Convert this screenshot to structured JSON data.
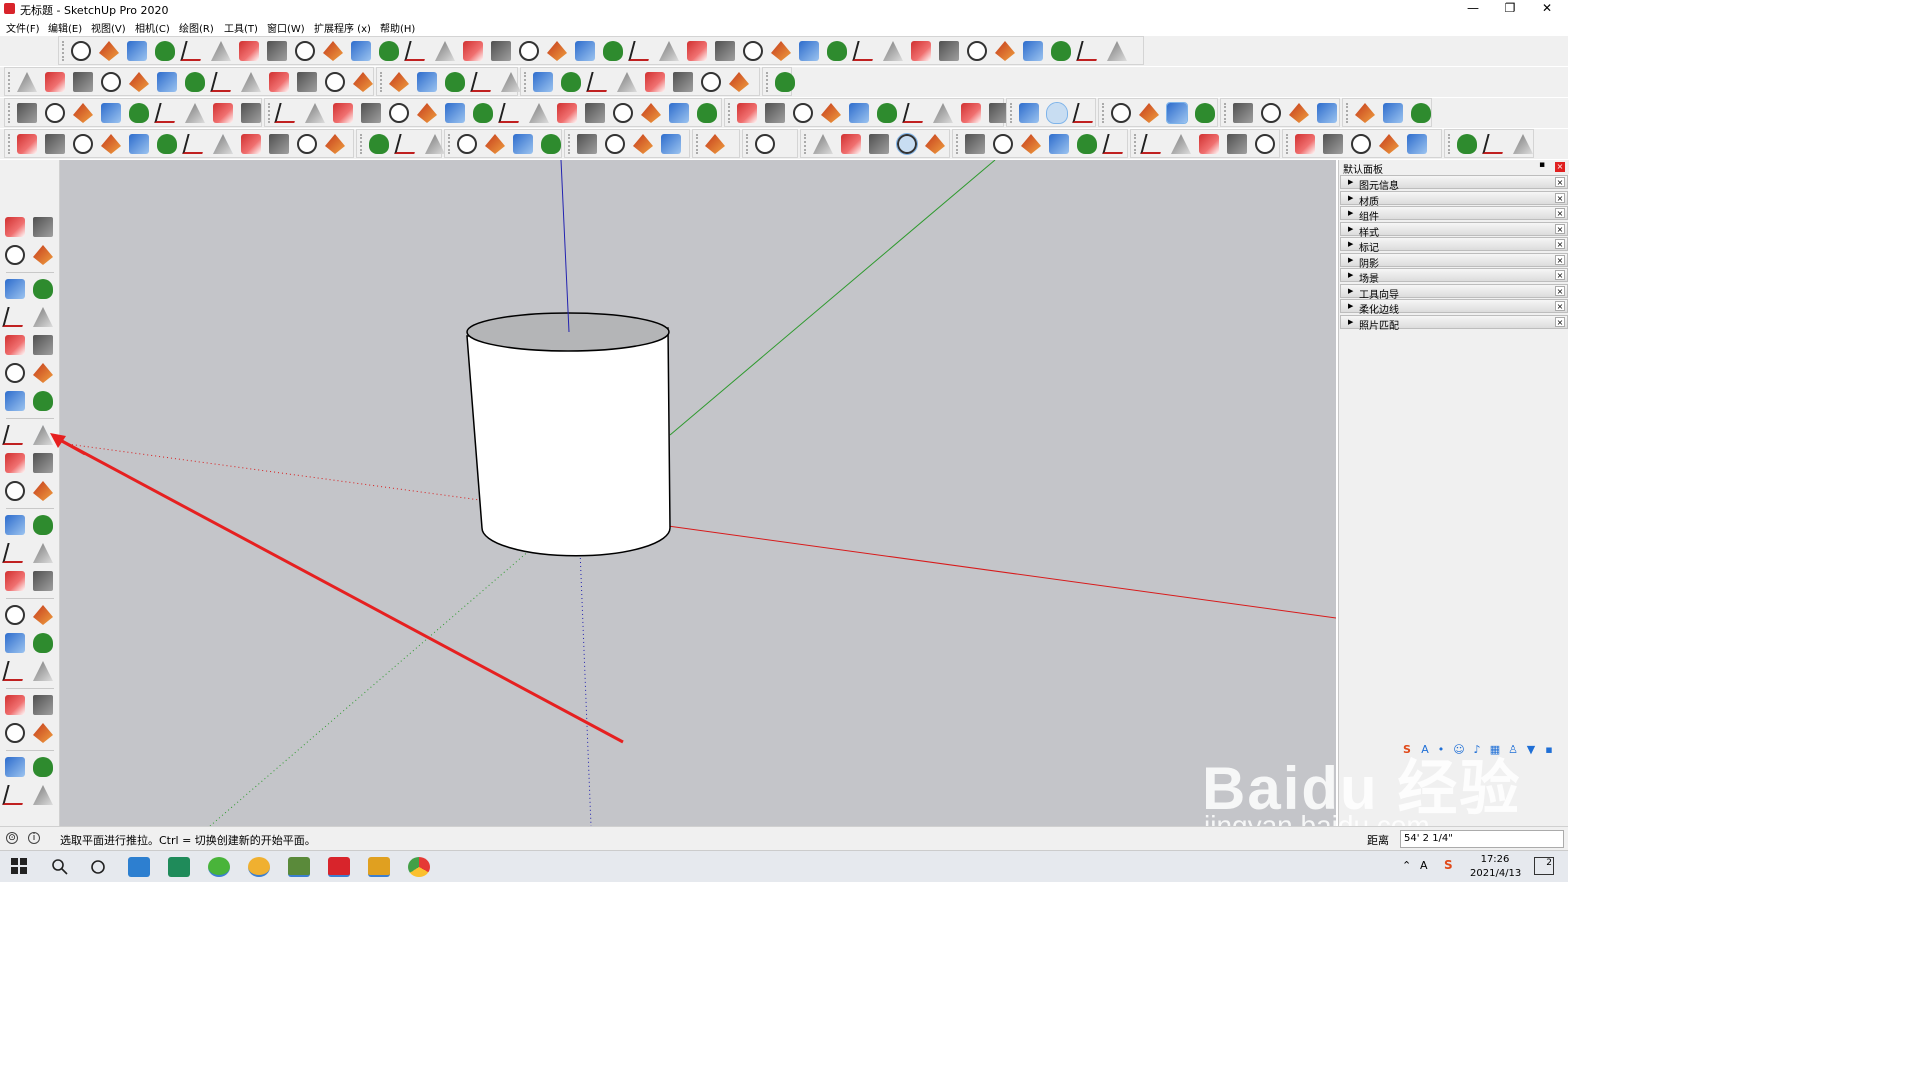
{
  "window": {
    "title": "无标题 - SketchUp Pro 2020",
    "controls": {
      "minimize": "—",
      "restore": "❐",
      "close": "✕"
    }
  },
  "menubar": {
    "items": [
      "文件(F)",
      "编辑(E)",
      "视图(V)",
      "相机(C)",
      "绘图(R)",
      "工具(T)",
      "窗口(W)",
      "扩展程序 (x)",
      "帮助(H)"
    ]
  },
  "toolbars": {
    "row_count": 4,
    "active_tool": "push-pull-tool",
    "left_toolbar_selected": "push-pull-tool"
  },
  "viewport": {
    "background_color": "#c4c5c9",
    "model": "cylinder",
    "axes_colors": {
      "red": "#d81b1b",
      "green": "#2e9a2e",
      "blue": "#2323b0"
    },
    "annotation_arrow_color": "#e62020"
  },
  "panel": {
    "title": "默认面板",
    "pin": "▪",
    "close": "×",
    "trays": [
      {
        "label": "图元信息"
      },
      {
        "label": "材质"
      },
      {
        "label": "组件"
      },
      {
        "label": "样式"
      },
      {
        "label": "标记"
      },
      {
        "label": "阴影"
      },
      {
        "label": "场景"
      },
      {
        "label": "工具向导"
      },
      {
        "label": "柔化边线"
      },
      {
        "label": "照片匹配"
      }
    ]
  },
  "statusbar": {
    "hint": "选取平面进行推拉。Ctrl = 切换创建新的开始平面。",
    "vcb_label": "距离",
    "vcb_value": "54' 2 1/4\""
  },
  "taskbar": {
    "time": "17:26",
    "date": "2021/4/13",
    "notification_count": "2"
  },
  "watermark": {
    "line1": "Baidu 经验",
    "line2": "jingyan.baidu.com"
  }
}
